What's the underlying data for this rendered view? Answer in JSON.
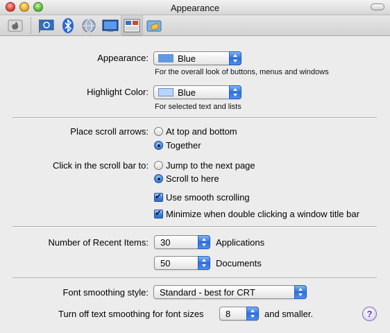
{
  "window": {
    "title": "Appearance"
  },
  "toolbar": {
    "icons": [
      "apple-icon",
      "international-flag-icon",
      "bluetooth-icon",
      "network-globe-icon",
      "desktop-screen-icon",
      "appearance-icon",
      "sharing-folder-icon"
    ]
  },
  "appearance": {
    "label": "Appearance:",
    "value": "Blue",
    "hint": "For the overall look of buttons, menus and windows",
    "swatch_color": "#5f9ae6"
  },
  "highlight": {
    "label": "Highlight Color:",
    "value": "Blue",
    "hint": "For selected text and lists",
    "swatch_color": "#b6d4ff"
  },
  "scroll_arrows": {
    "label": "Place scroll arrows:",
    "options": [
      "At top and bottom",
      "Together"
    ],
    "selected": 1
  },
  "scroll_click": {
    "label": "Click in the scroll bar to:",
    "options": [
      "Jump to the next page",
      "Scroll to here"
    ],
    "selected": 1
  },
  "checkboxes": {
    "smooth_scrolling": "Use smooth scrolling",
    "minimize_double_click": "Minimize when double clicking a window title bar"
  },
  "recent": {
    "label": "Number of Recent Items:",
    "applications_value": "30",
    "applications_label": "Applications",
    "documents_value": "50",
    "documents_label": "Documents"
  },
  "font_smoothing": {
    "label": "Font smoothing style:",
    "value": "Standard - best for CRT"
  },
  "text_smoothing": {
    "prefix": "Turn off text smoothing for font sizes",
    "value": "8",
    "suffix": "and smaller."
  },
  "help": {
    "label": "?"
  },
  "colors": {
    "accent": "#3b84e5"
  }
}
